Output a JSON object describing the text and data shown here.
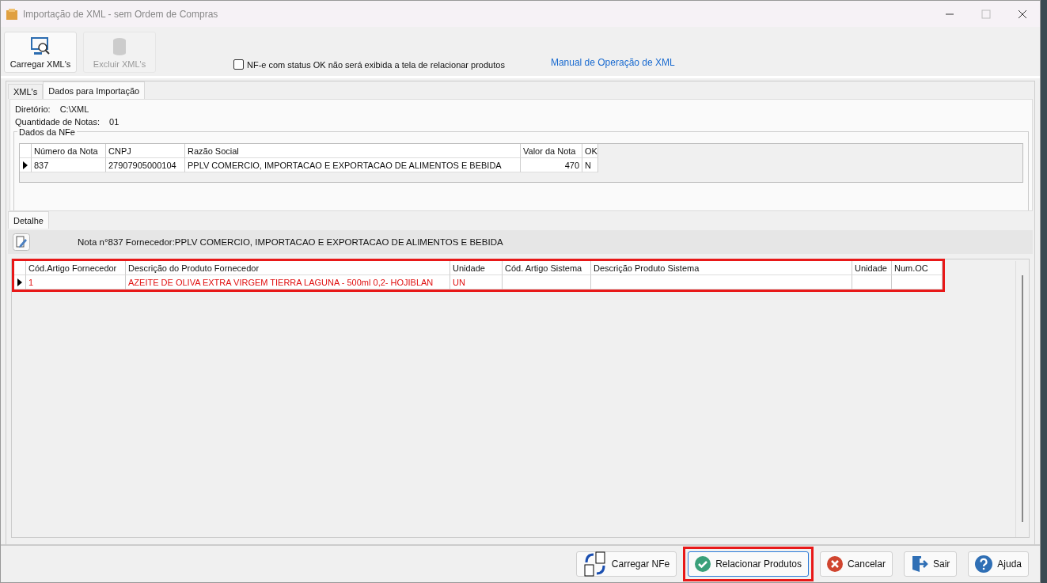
{
  "window": {
    "title": "Importação de XML - sem Ordem de Compras"
  },
  "toolbar": [
    {
      "label": "Carregar XML's",
      "disabled": false
    },
    {
      "label": "Excluir XML's",
      "disabled": true
    }
  ],
  "hide_ok_checkbox": {
    "label": "NF-e com status OK não será exibida a tela de relacionar produtos",
    "checked": false
  },
  "manual_link": "Manual de Operação de XML",
  "tabs": [
    {
      "label": "XML's",
      "selected": false
    },
    {
      "label": "Dados para Importação",
      "selected": true
    }
  ],
  "info": [
    {
      "label": "Diretório:",
      "value": "C:\\XML"
    },
    {
      "label": "Quantidade de Notas:",
      "value": "01"
    }
  ],
  "nfe_group": {
    "title": "Dados da NFe",
    "columns": [
      "Número da Nota",
      "CNPJ",
      "Razão Social",
      "Valor da Nota",
      "OK"
    ],
    "rows": [
      {
        "current": true,
        "cells": [
          "837",
          "27907905000104",
          "PPLV COMERCIO, IMPORTACAO E EXPORTACAO DE ALIMENTOS E BEBIDA",
          "470",
          "N"
        ]
      }
    ]
  },
  "detail_tab": {
    "label": "Detalhe",
    "selected": true
  },
  "detail_header": "Nota n°837 Fornecedor:PPLV COMERCIO, IMPORTACAO E EXPORTACAO DE ALIMENTOS E BEBIDA",
  "items_grid": {
    "highlighted": true,
    "columns": [
      "Cód.Artigo Fornecedor",
      "Descrição do Produto Fornecedor",
      "Unidade",
      "Cód. Artigo Sistema",
      "Descrição Produto Sistema",
      "Unidade",
      "Num.OC"
    ],
    "rows": [
      {
        "current": true,
        "unmatched": true,
        "cells": [
          "1",
          "AZEITE DE OLIVA EXTRA VIRGEM TIERRA LAGUNA - 500ml 0,2- HOJIBLAN",
          "UN",
          "",
          "",
          "",
          ""
        ]
      }
    ]
  },
  "buttons": [
    {
      "label": "Carregar NFe",
      "highlighted": false
    },
    {
      "label": "Relacionar Produtos",
      "highlighted": true
    },
    {
      "label": "Cancelar",
      "highlighted": false
    },
    {
      "label": "Sair",
      "highlighted": false
    },
    {
      "label": "Ajuda",
      "highlighted": false
    }
  ]
}
